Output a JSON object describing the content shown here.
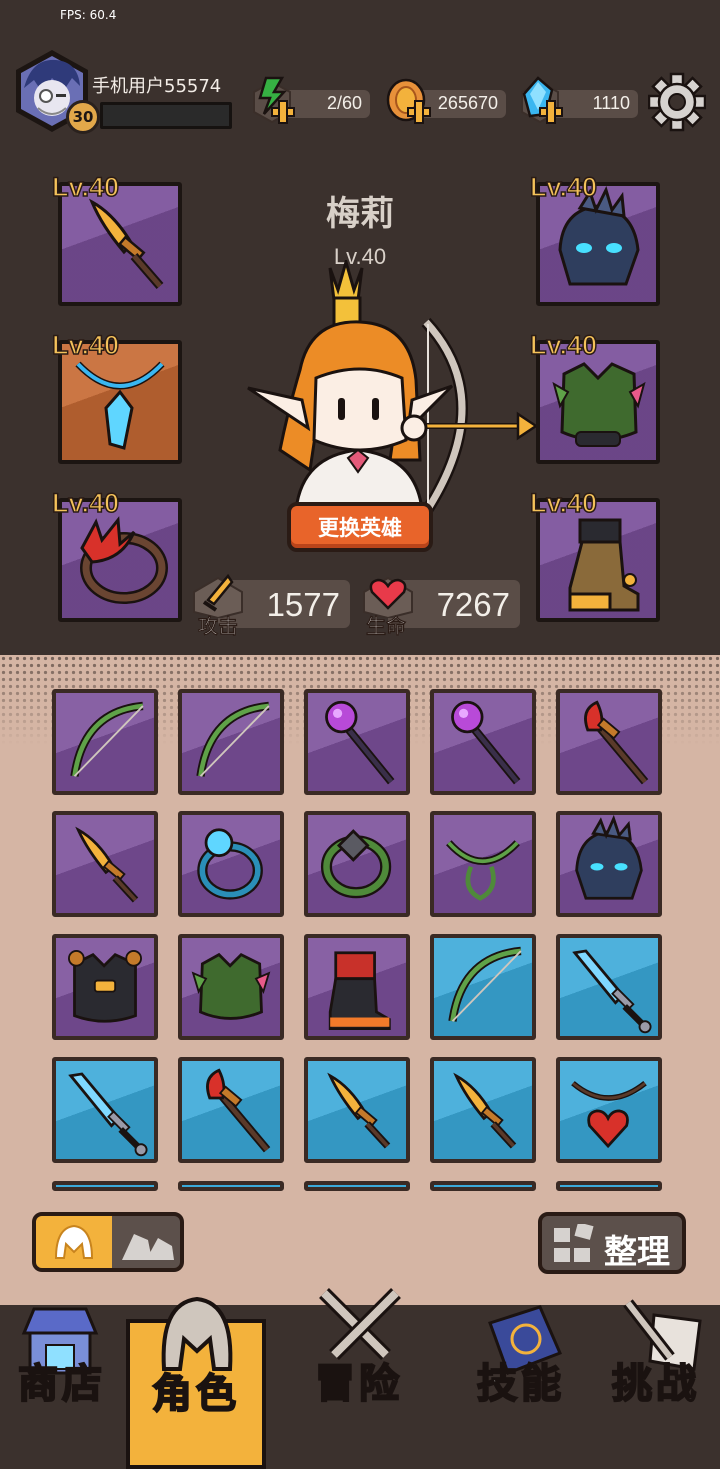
{
  "hud": {
    "fps": "FPS: 60.4"
  },
  "player": {
    "name": "手机用户55574",
    "level": "30"
  },
  "resources": {
    "energy": "2/60",
    "coins": "265670",
    "gems": "1110"
  },
  "hero": {
    "name": "梅莉",
    "level": "Lv.40",
    "change_label": "更换英雄"
  },
  "equipment": {
    "weapon": "Lv.40",
    "necklace": "Lv.40",
    "ring": "Lv.40",
    "helmet": "Lv.40",
    "armor": "Lv.40",
    "boots": "Lv.40"
  },
  "stats": {
    "attack_label": "攻击",
    "attack": "1577",
    "hp_label": "生命",
    "hp": "7267"
  },
  "inventory": {
    "items": [
      {
        "name": "vine-bow",
        "rarity": "purple"
      },
      {
        "name": "vine-bow",
        "rarity": "purple"
      },
      {
        "name": "orb-staff",
        "rarity": "purple"
      },
      {
        "name": "orb-staff",
        "rarity": "purple"
      },
      {
        "name": "flame-staff",
        "rarity": "purple"
      },
      {
        "name": "golden-sword",
        "rarity": "purple"
      },
      {
        "name": "frost-ring",
        "rarity": "purple"
      },
      {
        "name": "vine-ring",
        "rarity": "purple"
      },
      {
        "name": "vine-necklace",
        "rarity": "purple"
      },
      {
        "name": "dark-helmet",
        "rarity": "purple"
      },
      {
        "name": "dark-armor",
        "rarity": "purple"
      },
      {
        "name": "thorn-armor",
        "rarity": "purple"
      },
      {
        "name": "red-boots",
        "rarity": "purple"
      },
      {
        "name": "vine-bow",
        "rarity": "blue"
      },
      {
        "name": "ice-sword",
        "rarity": "blue"
      },
      {
        "name": "ice-sword",
        "rarity": "blue"
      },
      {
        "name": "flame-staff",
        "rarity": "blue"
      },
      {
        "name": "golden-sword",
        "rarity": "blue"
      },
      {
        "name": "golden-sword",
        "rarity": "blue"
      },
      {
        "name": "heart-necklace",
        "rarity": "blue"
      }
    ]
  },
  "controls": {
    "sort_label": "整理"
  },
  "nav": {
    "shop": "商店",
    "hero": "角色",
    "adventure": "冒险",
    "skills": "技能",
    "challenge": "挑战"
  },
  "colors": {
    "epic": "#7a4f9a",
    "rare": "#3aa8d8",
    "accent": "#f3b23c",
    "button": "#e8642a"
  }
}
